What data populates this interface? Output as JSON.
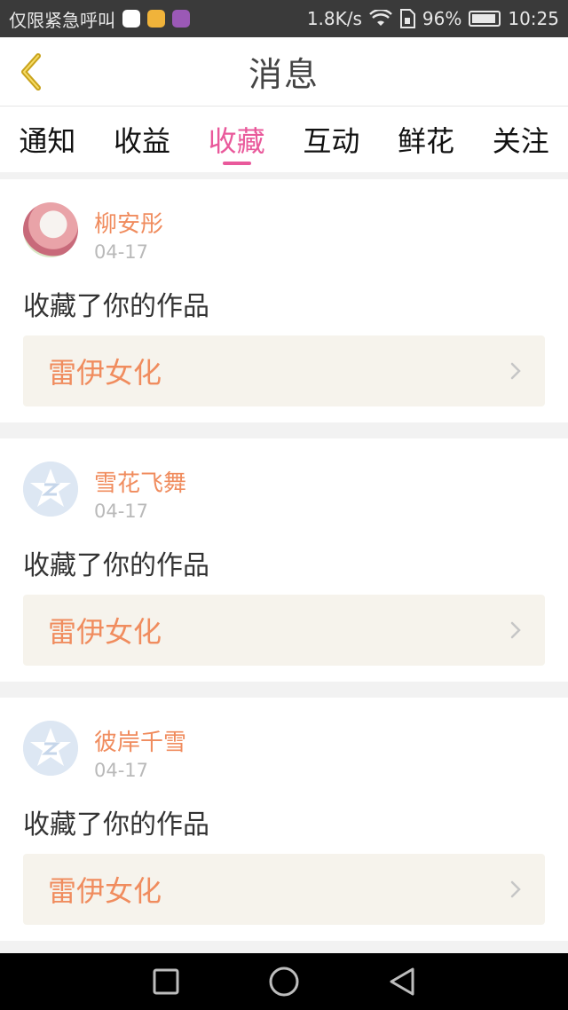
{
  "status_bar": {
    "carrier": "仅限紧急呼叫",
    "speed": "1.8K/s",
    "battery": "96%",
    "time": "10:25"
  },
  "header": {
    "title": "消息"
  },
  "tabs": [
    {
      "label": "通知",
      "active": false
    },
    {
      "label": "收益",
      "active": false
    },
    {
      "label": "收藏",
      "active": true
    },
    {
      "label": "互动",
      "active": false
    },
    {
      "label": "鲜花",
      "active": false
    },
    {
      "label": "关注",
      "active": false
    }
  ],
  "feed": [
    {
      "user": "柳安彤",
      "date": "04-17",
      "action": "收藏了你的作品",
      "work": "雷伊女化"
    },
    {
      "user": "雪花飞舞",
      "date": "04-17",
      "action": "收藏了你的作品",
      "work": "雷伊女化"
    },
    {
      "user": "彼岸千雪",
      "date": "04-17",
      "action": "收藏了你的作品",
      "work": "雷伊女化"
    }
  ],
  "colors": {
    "accent_pink": "#e9599b",
    "accent_orange": "#f08c5e",
    "card_bg": "#f6f3ec"
  }
}
